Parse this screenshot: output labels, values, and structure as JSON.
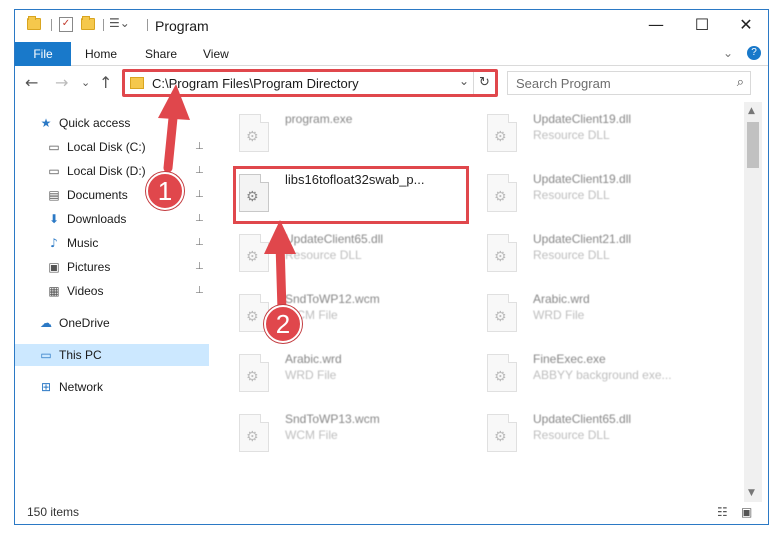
{
  "window": {
    "title": "Program",
    "controls": {
      "minimize": "—",
      "maximize": "☐",
      "close": "✕"
    }
  },
  "ribbon": {
    "tabs": [
      "File",
      "Home",
      "Share",
      "View"
    ],
    "expand_icon": "⌄",
    "help_icon": "?"
  },
  "nav": {
    "back": "←",
    "forward": "→",
    "recent": "⌄",
    "up": "↑",
    "address": "C:\\Program Files\\Program Directory",
    "address_dropdown": "⌄",
    "refresh": "↻",
    "search_placeholder": "Search Program",
    "search_icon": "⌕"
  },
  "sidebar": {
    "items": [
      {
        "label": "Quick access",
        "icon": "star-icon",
        "glyph": "★",
        "color": "#2b79c5",
        "pinned": false
      },
      {
        "label": "Local Disk (C:)",
        "icon": "drive-icon",
        "glyph": "▭",
        "color": "#555555",
        "pinned": true
      },
      {
        "label": "Local Disk (D:)",
        "icon": "drive-icon",
        "glyph": "▭",
        "color": "#555555",
        "pinned": true
      },
      {
        "label": "Documents",
        "icon": "document-icon",
        "glyph": "▤",
        "color": "#555555",
        "pinned": true
      },
      {
        "label": "Downloads",
        "icon": "download-icon",
        "glyph": "⬇",
        "color": "#2b79c5",
        "pinned": true
      },
      {
        "label": "Music",
        "icon": "music-icon",
        "glyph": "♪",
        "color": "#2b79c5",
        "pinned": true
      },
      {
        "label": "Pictures",
        "icon": "pictures-icon",
        "glyph": "▣",
        "color": "#555555",
        "pinned": true
      },
      {
        "label": "Videos",
        "icon": "video-icon",
        "glyph": "▦",
        "color": "#555555",
        "pinned": true
      },
      {
        "label": "OneDrive",
        "icon": "cloud-icon",
        "glyph": "☁",
        "color": "#2b79c5",
        "pinned": false
      },
      {
        "label": "This PC",
        "icon": "computer-icon",
        "glyph": "▭",
        "color": "#2b79c5",
        "pinned": false
      },
      {
        "label": "Network",
        "icon": "network-icon",
        "glyph": "⊞",
        "color": "#2b79c5",
        "pinned": false
      }
    ],
    "pin_glyph": "📌"
  },
  "files": [
    {
      "name": "program.exe",
      "type": ""
    },
    {
      "name": "UpdateClient19.dll",
      "type": "Resource DLL"
    },
    {
      "name": "libs16tofloat32swab_p...",
      "type": ""
    },
    {
      "name": "UpdateClient19.dll",
      "type": "Resource DLL"
    },
    {
      "name": "UpdateClient65.dll",
      "type": "Resource DLL"
    },
    {
      "name": "UpdateClient21.dll",
      "type": "Resource DLL"
    },
    {
      "name": "SndToWP12.wcm",
      "type": "WCM File"
    },
    {
      "name": "Arabic.wrd",
      "type": "WRD File"
    },
    {
      "name": "Arabic.wrd",
      "type": "WRD File"
    },
    {
      "name": "FineExec.exe",
      "type": "ABBYY background exe..."
    },
    {
      "name": "SndToWP13.wcm",
      "type": "WCM File"
    },
    {
      "name": "UpdateClient65.dll",
      "type": "Resource DLL"
    }
  ],
  "status": {
    "items": "150 items"
  },
  "steps": {
    "step1": "1",
    "step2": "2"
  },
  "colors": {
    "accent": "#1979ca",
    "highlight": "#e0474c",
    "selected": "#cce8ff"
  }
}
